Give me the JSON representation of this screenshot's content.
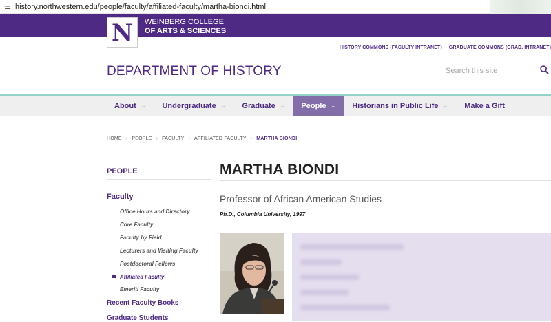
{
  "browser": {
    "url": "history.northwestern.edu/people/faculty/affiliated-faculty/martha-biondi.html"
  },
  "header": {
    "logo_letter": "N",
    "college_line1": "WEINBERG COLLEGE",
    "college_line2": "OF ARTS & SCIENCES",
    "utility_links": [
      "HISTORY COMMONS (FACULTY INTRANET)",
      "GRADUATE COMMONS (GRAD. INTRANET)"
    ],
    "department": "DEPARTMENT OF HISTORY",
    "search_placeholder": "Search this site"
  },
  "nav": {
    "items": [
      {
        "label": "About",
        "chevron": "⌄"
      },
      {
        "label": "Undergraduate",
        "chevron": "⌄"
      },
      {
        "label": "Graduate",
        "chevron": "⌄"
      },
      {
        "label": "People",
        "chevron": "⌄"
      },
      {
        "label": "Historians in Public Life",
        "chevron": "⌄"
      },
      {
        "label": "Make a Gift",
        "chevron": ""
      }
    ],
    "active_index": 3
  },
  "breadcrumb": [
    "HOME",
    "PEOPLE",
    "FACULTY",
    "AFFILIATED FACULTY",
    "MARTHA BIONDI"
  ],
  "sidebar": {
    "title": "PEOPLE",
    "faculty": "Faculty",
    "sub_items": [
      "Office Hours and Directory",
      "Core Faculty",
      "Faculty by Field",
      "Lecturers and Visiting Faculty",
      "Postdoctoral Fellows",
      "Affiliated Faculty",
      "Emeriti Faculty"
    ],
    "active_sub_index": 5,
    "main_items": [
      "Recent Faculty Books",
      "Graduate Students"
    ]
  },
  "profile": {
    "name": "MARTHA BIONDI",
    "title": "Professor of African American Studies",
    "degree": "Ph.D., Columbia University, 1997"
  },
  "colors": {
    "brand_purple": "#4e2a84",
    "active_nav": "#836eaa",
    "accent_teal": "#8ed2c8"
  }
}
